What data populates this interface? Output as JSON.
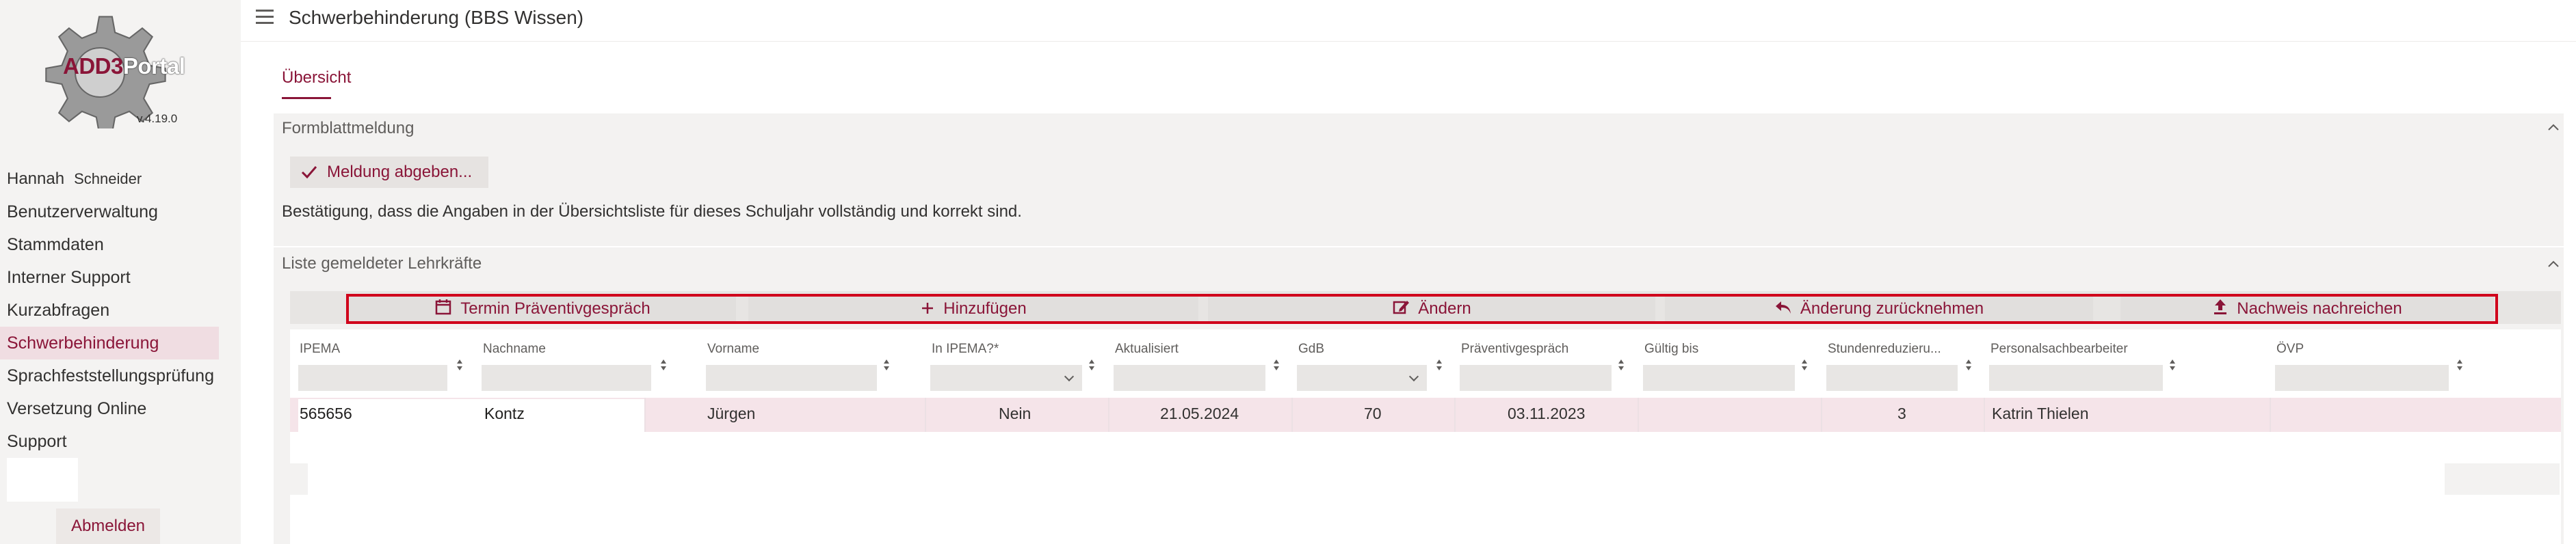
{
  "sidebar": {
    "logo_main": "ADD3",
    "logo_accent": "Portal",
    "version": "v.4.19.0",
    "user_first": "Hannah",
    "user_last": "Schneider",
    "items": [
      {
        "label": "Benutzerverwaltung"
      },
      {
        "label": "Stammdaten"
      },
      {
        "label": "Interner Support"
      },
      {
        "label": "Kurzabfragen"
      },
      {
        "label": "Schwerbehinderung"
      },
      {
        "label": "Sprachfeststellungsprüfung"
      },
      {
        "label": "Versetzung Online"
      },
      {
        "label": "Support"
      }
    ],
    "logout_label": "Abmelden"
  },
  "header": {
    "title": "Schwerbehinderung (BBS Wissen)"
  },
  "tabs": [
    {
      "label": "Übersicht"
    }
  ],
  "formblatt": {
    "title": "Formblattmeldung",
    "button_label": "Meldung abgeben...",
    "confirm_text": "Bestätigung, dass die Angaben in der Übersichtsliste für dieses Schuljahr vollständig und korrekt sind."
  },
  "liste": {
    "title": "Liste gemeldeter Lehrkräfte",
    "toolbar": [
      {
        "label": "Termin Präventivgespräch",
        "icon": "calendar-icon"
      },
      {
        "label": "Hinzufügen",
        "icon": "plus-icon"
      },
      {
        "label": "Ändern",
        "icon": "edit-icon"
      },
      {
        "label": "Änderung zurücknehmen",
        "icon": "undo-icon"
      },
      {
        "label": "Nachweis nachreichen",
        "icon": "upload-icon"
      }
    ],
    "columns": [
      "IPEMA",
      "Nachname",
      "Vorname",
      "In IPEMA?*",
      "Aktualisiert",
      "GdB",
      "Präventivgespräch",
      "Gültig bis",
      "Stundenreduzieru...",
      "Personalsachbearbeiter",
      "ÖVP"
    ],
    "rows": [
      {
        "ipema": "565656",
        "nachname": "Kontz",
        "vorname": "Jürgen",
        "in_ipema": "Nein",
        "aktualisiert": "21.05.2024",
        "gdb": "70",
        "praeventiv": "03.11.2023",
        "gueltig": "",
        "stunden": "3",
        "sachbearbeiter": "Katrin Thielen",
        "oevp": ""
      }
    ]
  },
  "colors": {
    "accent": "#8a1538",
    "outline": "#d0021b",
    "row_highlight": "#f5e4e9"
  }
}
